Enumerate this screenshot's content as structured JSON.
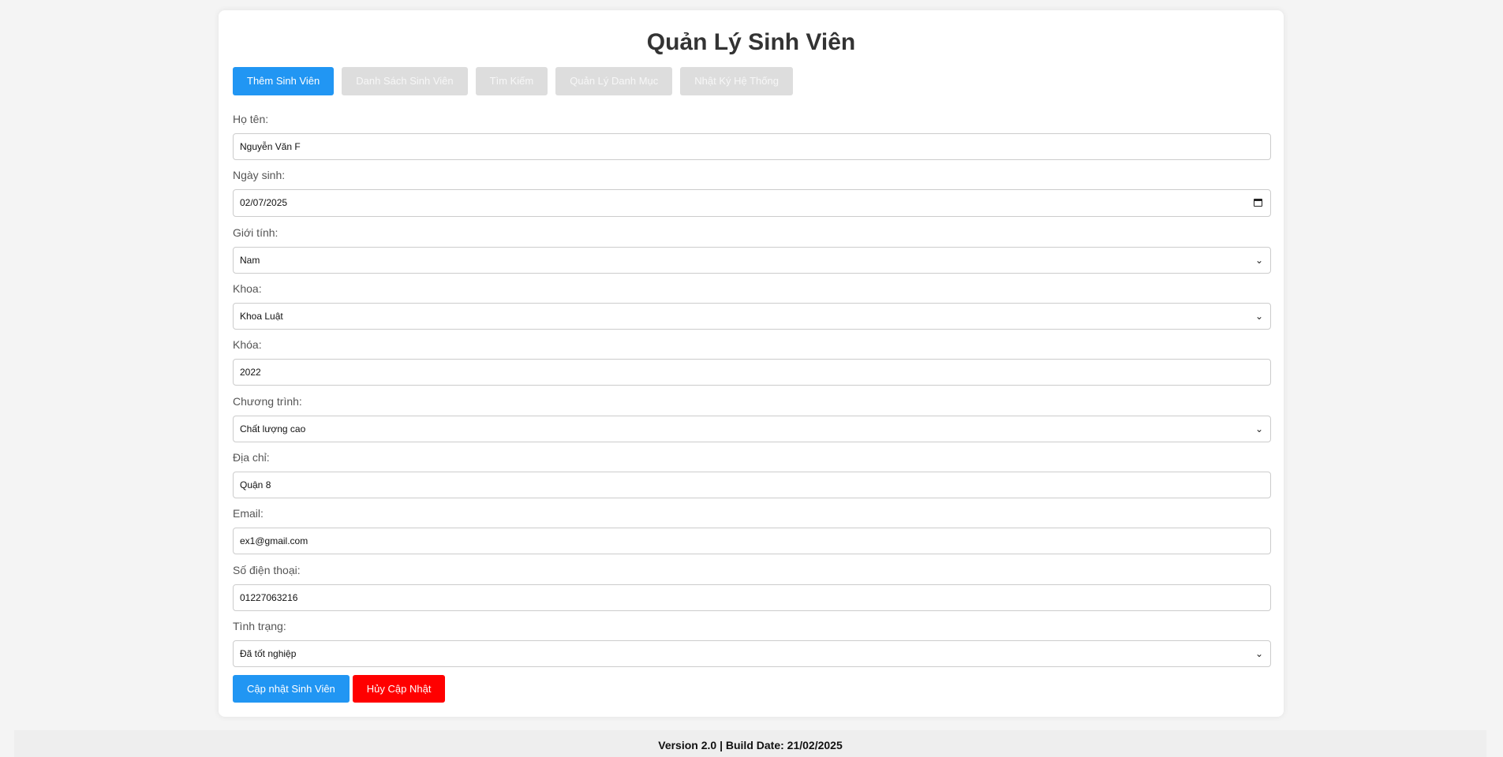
{
  "header": {
    "title": "Quản Lý Sinh Viên"
  },
  "tabs": [
    {
      "label": "Thêm Sinh Viên",
      "active": true
    },
    {
      "label": "Danh Sách Sinh Viên",
      "active": false
    },
    {
      "label": "Tìm Kiếm",
      "active": false
    },
    {
      "label": "Quản Lý Danh Mục",
      "active": false
    },
    {
      "label": "Nhật Ký Hệ Thống",
      "active": false
    }
  ],
  "form": {
    "name": {
      "label": "Họ tên:",
      "value": "Nguyễn Văn F"
    },
    "dob": {
      "label": "Ngày sinh:",
      "value": "02/07/2025"
    },
    "gender": {
      "label": "Giới tính:",
      "value": "Nam"
    },
    "faculty": {
      "label": "Khoa:",
      "value": "Khoa Luật"
    },
    "course": {
      "label": "Khóa:",
      "value": "2022"
    },
    "program": {
      "label": "Chương trình:",
      "value": "Chất lượng cao"
    },
    "address": {
      "label": "Địa chỉ:",
      "value": "Quận 8"
    },
    "email": {
      "label": "Email:",
      "value": "ex1@gmail.com"
    },
    "phone": {
      "label": "Số điện thoại:",
      "value": "01227063216"
    },
    "status": {
      "label": "Tình trạng:",
      "value": "Đã tốt nghiệp"
    }
  },
  "actions": {
    "update_label": "Cập nhật Sinh Viên",
    "cancel_label": "Hủy Cập Nhật"
  },
  "footer": {
    "text": "Version 2.0 | Build Date: 21/02/2025"
  },
  "colors": {
    "primary": "#2196f3",
    "danger": "#ff0000",
    "inactive_tab": "#dddddd"
  },
  "icons": {
    "select": "chevron-down-icon",
    "date": "calendar-icon"
  }
}
